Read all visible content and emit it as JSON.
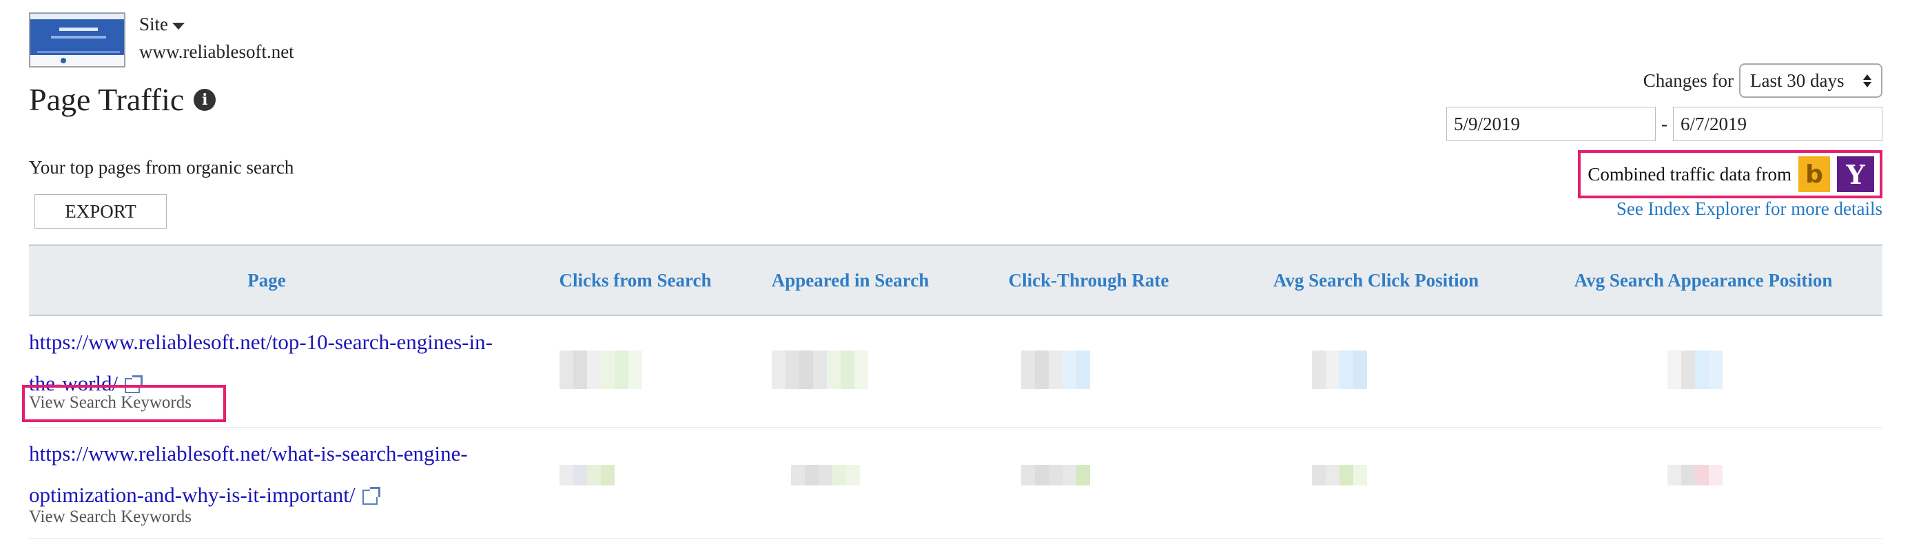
{
  "site": {
    "label": "Site",
    "url": "www.reliablesoft.net",
    "thumbnail_icon": "website-thumbnail"
  },
  "page_title": "Page Traffic",
  "subtitle": "Your top pages from organic search",
  "export_label": "EXPORT",
  "changes_for_label": "Changes for",
  "period_select": {
    "value": "Last 30 days"
  },
  "date_range": {
    "from": "5/9/2019",
    "separator": "-",
    "to": "6/7/2019"
  },
  "combined_label": "Combined traffic data from",
  "see_index_link": "See Index Explorer for more details",
  "table": {
    "columns": [
      "Page",
      "Clicks from Search",
      "Appeared in Search",
      "Click-Through Rate",
      "Avg Search Click Position",
      "Avg Search Appearance Position"
    ],
    "rows": [
      {
        "url": "https://www.reliablesoft.net/top-10-search-engines-in-the-world/",
        "keywords_link": "View Search Keywords"
      },
      {
        "url": "https://www.reliablesoft.net/what-is-search-engine-optimization-and-why-is-it-important/",
        "keywords_link": "View Search Keywords"
      }
    ]
  },
  "colors": {
    "link": "#1a14b8",
    "header_link": "#2f7dc6",
    "highlight": "#e4206e",
    "bing": "#f5b21c",
    "yahoo": "#5f1e87"
  }
}
